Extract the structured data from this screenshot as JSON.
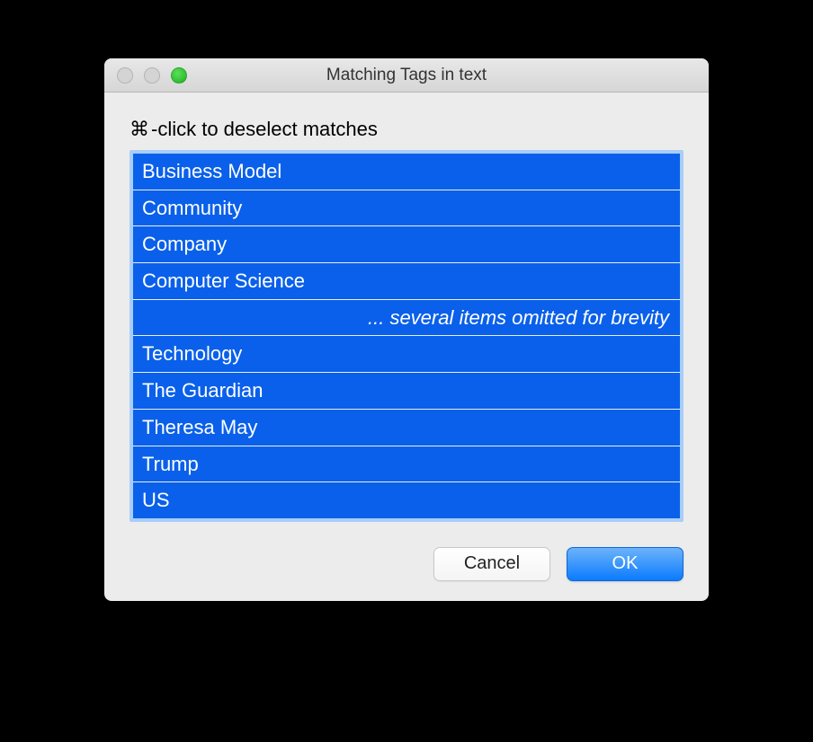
{
  "window": {
    "title": "Matching Tags in text"
  },
  "instruction": {
    "icon": "⌘",
    "text": "-click to deselect matches"
  },
  "list": {
    "items": [
      "Business Model",
      "Community",
      "Company",
      "Computer Science",
      "... several items omitted for brevity",
      "Technology",
      "The Guardian",
      "Theresa May",
      "Trump",
      "US"
    ],
    "omitted_index": 4
  },
  "buttons": {
    "cancel": "Cancel",
    "ok": "OK"
  }
}
